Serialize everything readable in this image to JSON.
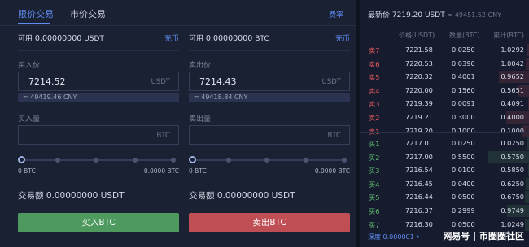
{
  "tabs": [
    {
      "label": "限价交易",
      "active": true
    },
    {
      "label": "市价交易",
      "active": false
    }
  ],
  "rate_link": "费率",
  "buy": {
    "available_label": "可用",
    "available_value": "0.00000000",
    "available_unit": "USDT",
    "charge_label": "充币",
    "price_label": "买入价",
    "price_value": "7214.52",
    "price_unit": "USDT",
    "cny_value": "≈ 49419.46 CNY",
    "qty_label": "买入量",
    "qty_unit": "BTC",
    "range_min": "0 BTC",
    "range_max": "0.0000 BTC",
    "amount_label": "交易额",
    "amount_value": "0.00000000 USDT",
    "button_label": "买入BTC"
  },
  "sell": {
    "available_label": "可用",
    "available_value": "0.00000000",
    "available_unit": "BTC",
    "charge_label": "充币",
    "price_label": "卖出价",
    "price_value": "7214.43",
    "price_unit": "USDT",
    "cny_value": "≈ 49418.84 CNY",
    "qty_label": "卖出量",
    "qty_unit": "BTC",
    "range_min": "0 BTC",
    "range_max": "0.0000 BTC",
    "amount_label": "交易额",
    "amount_value": "0.00000000 USDT",
    "button_label": "卖出BTC"
  },
  "orderbook": {
    "latest_label": "最新价",
    "latest_price": "7219.20 USDT",
    "latest_cny": "≈ 49451.52 CNY",
    "headers": {
      "price": "价格(USDT)",
      "qty": "数量(BTC)",
      "cum": "累计(BTC)"
    },
    "asks": [
      {
        "label": "卖7",
        "price": "7221.58",
        "qty": "0.0250",
        "cum": "1.0292"
      },
      {
        "label": "卖6",
        "price": "7220.53",
        "qty": "0.0390",
        "cum": "1.0042"
      },
      {
        "label": "卖5",
        "price": "7220.32",
        "qty": "0.4001",
        "cum": "0.9652"
      },
      {
        "label": "卖4",
        "price": "7220.00",
        "qty": "0.1560",
        "cum": "0.5651"
      },
      {
        "label": "卖3",
        "price": "7219.39",
        "qty": "0.0091",
        "cum": "0.4091"
      },
      {
        "label": "卖2",
        "price": "7219.21",
        "qty": "0.3000",
        "cum": "0.4000"
      },
      {
        "label": "卖1",
        "price": "7219.20",
        "qty": "0.1000",
        "cum": "0.1000"
      }
    ],
    "bids": [
      {
        "label": "买1",
        "price": "7217.01",
        "qty": "0.0250",
        "cum": "0.0250"
      },
      {
        "label": "买2",
        "price": "7217.00",
        "qty": "0.5500",
        "cum": "0.5750"
      },
      {
        "label": "买3",
        "price": "7216.54",
        "qty": "0.0100",
        "cum": "0.5850"
      },
      {
        "label": "买4",
        "price": "7216.45",
        "qty": "0.0400",
        "cum": "0.6250"
      },
      {
        "label": "买5",
        "price": "7216.44",
        "qty": "0.0500",
        "cum": "0.6750"
      },
      {
        "label": "买6",
        "price": "7216.37",
        "qty": "0.2999",
        "cum": "0.9749"
      },
      {
        "label": "买7",
        "price": "7216.30",
        "qty": "0.0500",
        "cum": "1.0249"
      }
    ],
    "depth_label": "深度 0.000001 ▾",
    "watermark": "网易号 | 币圈圈社区"
  },
  "colors": {
    "accent": "#5f8cf2",
    "buy": "#4e9a5e",
    "sell": "#c04e55"
  }
}
